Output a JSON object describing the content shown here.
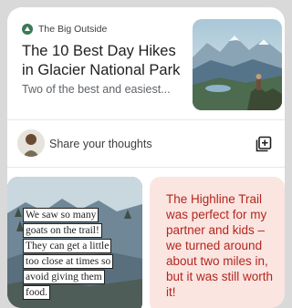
{
  "article": {
    "source_name": "The Big Outside",
    "source_icon": "mountain-logo-icon",
    "headline": "The 10 Best Day Hikes in Glacier National Park",
    "snippet": "Two of the best and easiest..."
  },
  "comment_box": {
    "placeholder": "Share your thoughts",
    "add_icon": "add-post-icon"
  },
  "posts": {
    "photo_caption_lines": [
      "We saw so many",
      "goats on the trail!",
      "They can get a little",
      "too close at times so",
      "avoid giving them",
      "food."
    ],
    "text_post": "The Highline Trail was perfect for my partner and kids – we turned around about two miles in, but it was still worth it!"
  },
  "colors": {
    "text_post_bg": "#fbe5e1",
    "text_post_fg": "#b3261e",
    "background": "#d9d9d9"
  }
}
